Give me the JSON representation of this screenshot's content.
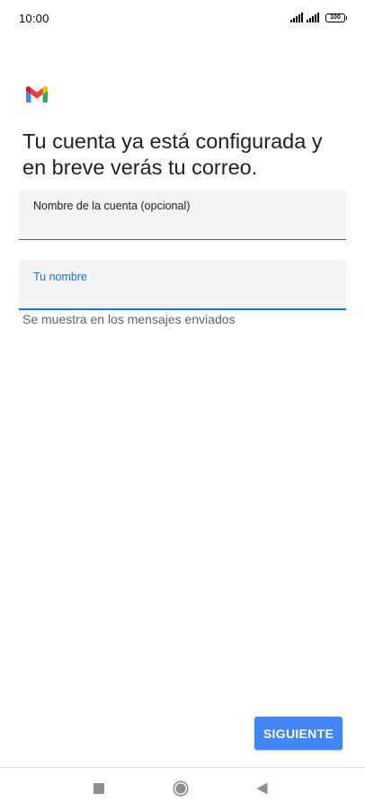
{
  "status_bar": {
    "time": "10:00",
    "battery": "100"
  },
  "icons": {
    "app_logo": "gmail-logo",
    "signal": "signal-icon",
    "battery": "battery-icon",
    "nav_recents": "square-icon",
    "nav_home": "circle-icon",
    "nav_back": "triangle-back-icon"
  },
  "headline": "Tu cuenta ya está configurada y en breve verás tu correo.",
  "account_name_field": {
    "label": "Nombre de la cuenta (opcional)",
    "value": ""
  },
  "your_name_field": {
    "label": "Tu nombre",
    "value": "",
    "helper": "Se muestra en los mensajes enviados"
  },
  "next_button_label": "SIGUIENTE",
  "colors": {
    "accent": "#1a73e8",
    "button": "#4285f4",
    "field_background": "#f1f3f4"
  }
}
